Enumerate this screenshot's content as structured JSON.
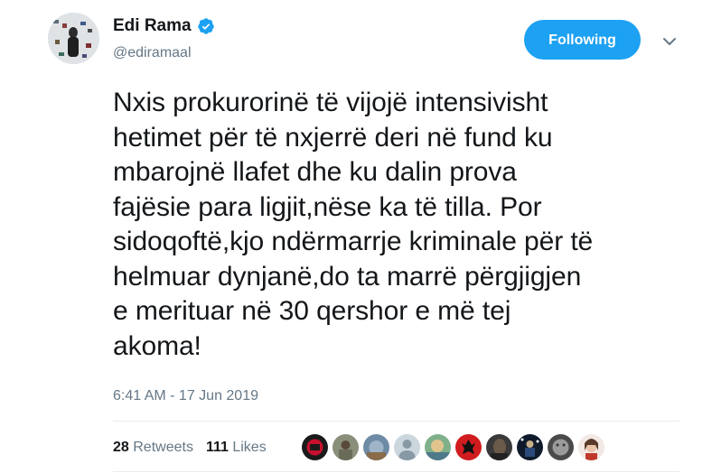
{
  "user": {
    "display_name": "Edi Rama",
    "handle": "@ediramaal"
  },
  "follow_button": {
    "label": "Following"
  },
  "tweet": {
    "text": "Nxis prokurorinë të vijojë intensivisht\nhetimet për të nxjerrë deri në fund ku\nmbarojnë llafet dhe ku dalin prova\nfajësie para ligjit,nëse ka të tilla. Por\nsidoqoftë,kjo ndërmarrje kriminale për të\nhelmuar dynjanë,do ta marrë përgjigjen\ne merituar në 30 qershor e më tej\nakoma!",
    "timestamp": "6:41 AM - 17 Jun 2019"
  },
  "stats": {
    "retweets_count": "28",
    "retweets_label": "Retweets",
    "likes_count": "111",
    "likes_label": "Likes"
  },
  "colors": {
    "accent": "#1da1f2",
    "secondary_text": "#657786",
    "divider": "#e6ecf0"
  },
  "icons": {
    "verified": "verified-badge-icon",
    "chevron": "chevron-down-icon"
  }
}
